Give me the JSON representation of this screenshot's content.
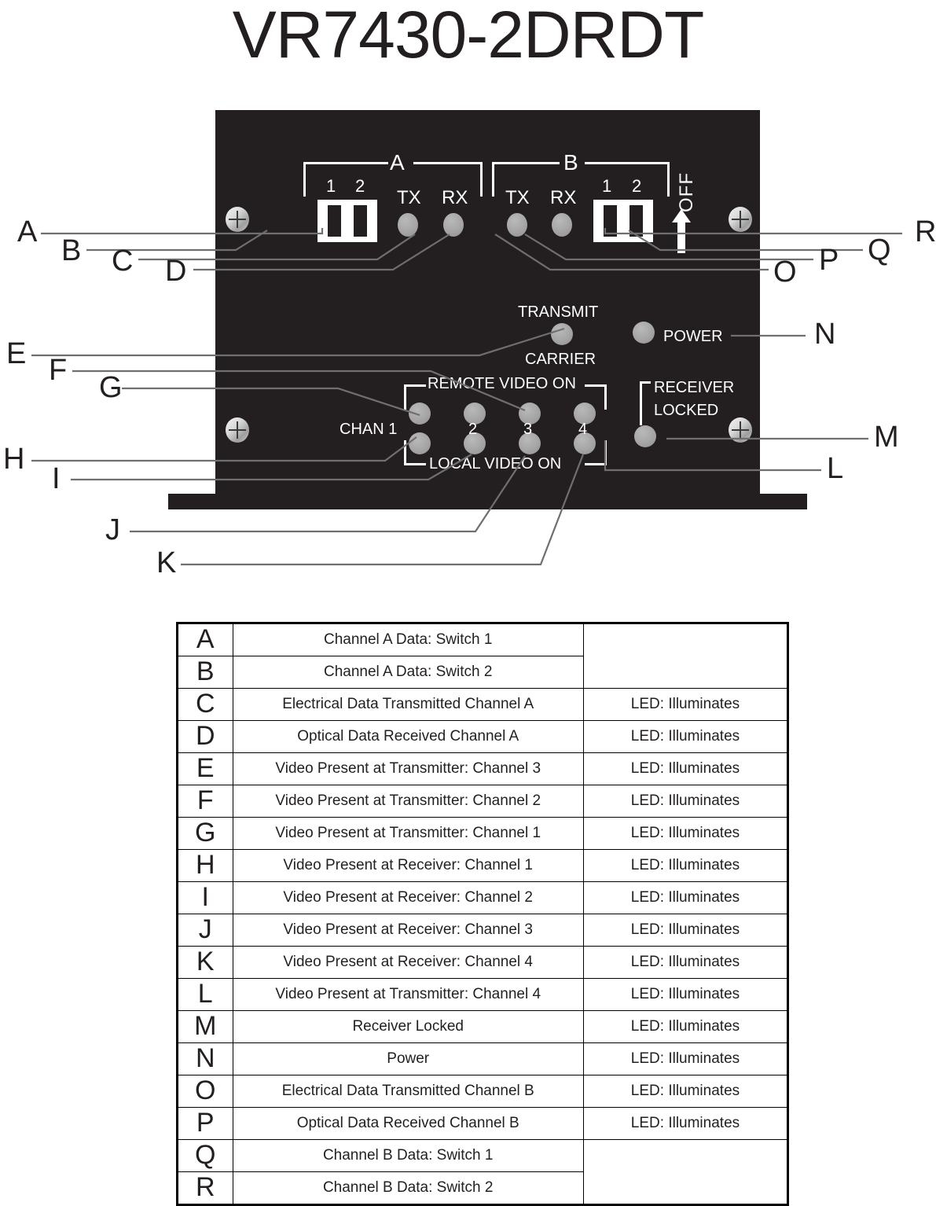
{
  "title": "VR7430-2DRDT",
  "device": {
    "channel_groups": [
      {
        "label": "A",
        "switch_numbers": [
          "1",
          "2"
        ],
        "indicators": [
          "TX",
          "RX"
        ]
      },
      {
        "label": "B",
        "switch_numbers": [
          "1",
          "2"
        ],
        "indicators": [
          "TX",
          "RX"
        ]
      }
    ],
    "off_label": "OFF",
    "transmit_label": "TRANSMIT",
    "carrier_label": "CARRIER",
    "power_label": "POWER",
    "receiver_locked_line1": "RECEIVER",
    "receiver_locked_line2": "LOCKED",
    "remote_video_label": "REMOTE VIDEO ON",
    "local_video_label": "LOCAL VIDEO ON",
    "chan_label": "CHAN 1",
    "chan_numbers": [
      "2",
      "3",
      "4"
    ],
    "panel_color": "#231f20",
    "led_color": "#a5a5a5",
    "text_color": "#ffffff"
  },
  "callouts_left": [
    "A",
    "B",
    "C",
    "D",
    "E",
    "F",
    "G",
    "H",
    "I",
    "J",
    "K"
  ],
  "callouts_right": [
    "R",
    "Q",
    "P",
    "O",
    "N",
    "M",
    "L"
  ],
  "legend": {
    "rows": [
      {
        "key": "A",
        "desc": "Channel A Data: Switch 1",
        "led": ""
      },
      {
        "key": "B",
        "desc": "Channel A Data: Switch 2",
        "led": ""
      },
      {
        "key": "C",
        "desc": "Electrical Data Transmitted Channel A",
        "led": "LED: Illuminates"
      },
      {
        "key": "D",
        "desc": "Optical Data Received Channel A",
        "led": "LED: Illuminates"
      },
      {
        "key": "E",
        "desc": "Video Present at Transmitter: Channel 3",
        "led": "LED: Illuminates"
      },
      {
        "key": "F",
        "desc": "Video Present at Transmitter: Channel 2",
        "led": "LED: Illuminates"
      },
      {
        "key": "G",
        "desc": "Video Present at Transmitter: Channel 1",
        "led": "LED: Illuminates"
      },
      {
        "key": "H",
        "desc": "Video Present at Receiver: Channel 1",
        "led": "LED: Illuminates"
      },
      {
        "key": "I",
        "desc": "Video Present at Receiver: Channel 2",
        "led": "LED: Illuminates"
      },
      {
        "key": "J",
        "desc": "Video Present at Receiver: Channel 3",
        "led": "LED: Illuminates"
      },
      {
        "key": "K",
        "desc": "Video Present at Receiver: Channel 4",
        "led": "LED: Illuminates"
      },
      {
        "key": "L",
        "desc": "Video Present at Transmitter: Channel 4",
        "led": "LED: Illuminates"
      },
      {
        "key": "M",
        "desc": "Receiver Locked",
        "led": "LED: Illuminates"
      },
      {
        "key": "N",
        "desc": "Power",
        "led": "LED: Illuminates"
      },
      {
        "key": "O",
        "desc": "Electrical Data Transmitted Channel B",
        "led": "LED: Illuminates"
      },
      {
        "key": "P",
        "desc": "Optical Data Received Channel B",
        "led": "LED: Illuminates"
      },
      {
        "key": "Q",
        "desc": "Channel B Data: Switch 1",
        "led": ""
      },
      {
        "key": "R",
        "desc": "Channel B Data: Switch 2",
        "led": ""
      }
    ]
  }
}
